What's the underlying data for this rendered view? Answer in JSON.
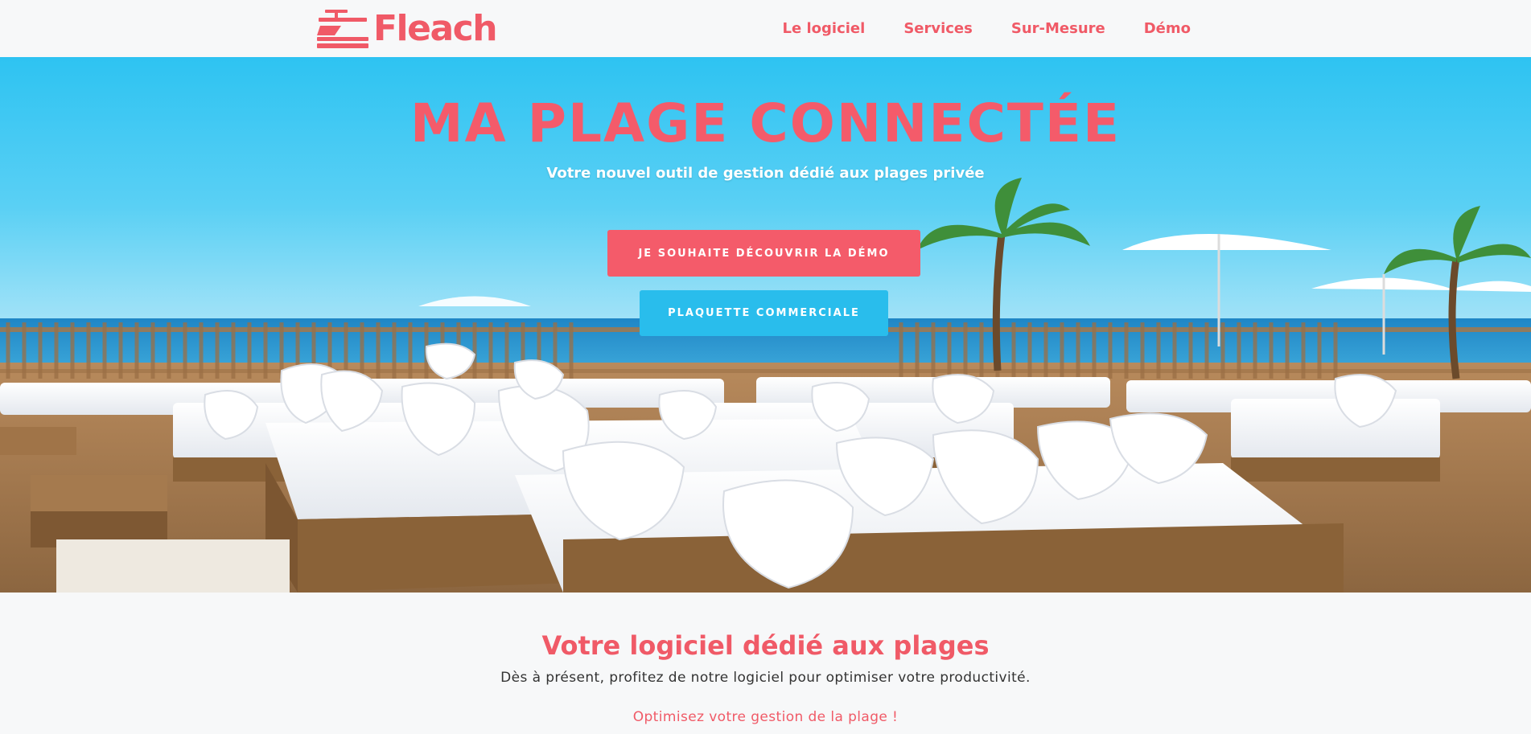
{
  "brand": {
    "name": "Fleach",
    "color": "#f05a67",
    "icon": "beach-lounger-logo-icon"
  },
  "nav": {
    "items": [
      {
        "label": "Le logiciel"
      },
      {
        "label": "Services"
      },
      {
        "label": "Sur-Mesure"
      },
      {
        "label": "Démo"
      }
    ]
  },
  "hero": {
    "title": "MA PLAGE CONNECTÉE",
    "subtitle": "Votre nouvel outil de gestion dédié aux plages privée",
    "primary_button": "JE SOUHAITE DÉCOUVRIR LA DÉMO",
    "secondary_button": "PLAQUETTE COMMERCIALE",
    "primary_color": "#f45b6a",
    "secondary_color": "#29bdec",
    "background": "beach-club-daybeds-photo"
  },
  "intro": {
    "title": "Votre logiciel dédié aux plages",
    "text": "Dès à présent, profitez de notre logiciel pour optimiser votre productivité.",
    "link": "Optimisez votre gestion de la plage !"
  }
}
